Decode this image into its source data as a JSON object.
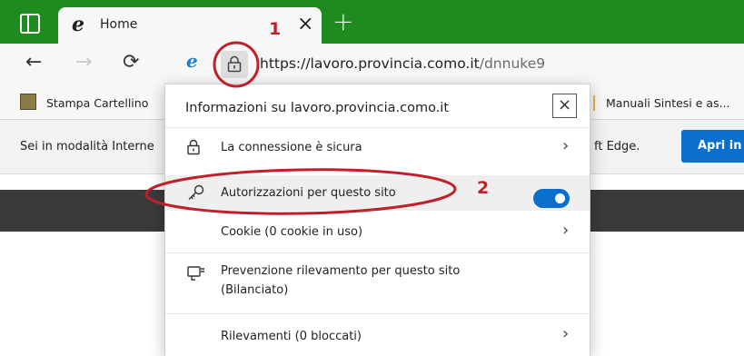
{
  "tab": {
    "title": "Home",
    "favicon": "e",
    "close_symbol": "×",
    "new_tab_symbol": "+"
  },
  "toolbar": {
    "back_symbol": "←",
    "forward_symbol": "→",
    "refresh_symbol": "⟳",
    "ie_mode_icon": "e",
    "url_host": "https://lavoro.provincia.como.it",
    "url_path": "/dnnuke9"
  },
  "bookmarks": {
    "items": [
      {
        "label": "Stampa Cartellino"
      },
      {
        "label": "Manuali Sintesi e as..."
      }
    ]
  },
  "infobar": {
    "text_left": "Sei in modalità Interne",
    "text_right": "ft Edge.",
    "button_label": "Apri in M"
  },
  "popup": {
    "title": "Informazioni su lavoro.provincia.como.it",
    "close_symbol": "×",
    "rows": [
      {
        "label": "La connessione è sicura",
        "icon": "lock-icon"
      },
      {
        "label": "Autorizzazioni per questo sito",
        "icon": "key-icon"
      },
      {
        "label": "Cookie (0 cookie in uso)",
        "icon": ""
      },
      {
        "label": "Prevenzione rilevamento per questo sito",
        "sub": "(Bilanciato)",
        "icon": "tracking-prevention-icon"
      },
      {
        "label": "Rilevamenti (0 bloccati)",
        "icon": ""
      }
    ],
    "chevron": "›",
    "tracking_toggle_on": true
  },
  "annotations": {
    "label_1": "1",
    "label_2": "2",
    "color": "#c0202a"
  },
  "colors": {
    "tabstrip": "#1e8b1e",
    "accent": "#0a6fcc"
  }
}
